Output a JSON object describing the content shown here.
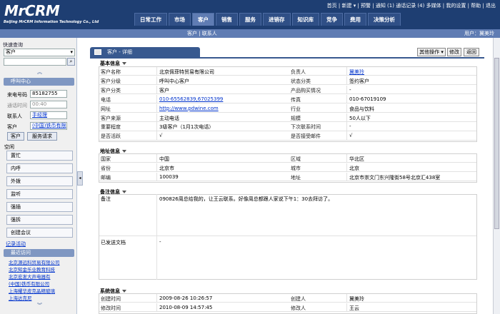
{
  "header": {
    "logo": "MrCRM",
    "logo_sub": "BeiJing MrCRM Information Technology Co., Ltd",
    "toplinks": "首页 | 新建 ▾ | 预警 | 通知 (1) 通话记录 (4) 多媒体 | 我的设置 | 帮助 | 退出",
    "nav": [
      "日常工作",
      "市场",
      "客户",
      "销售",
      "服务",
      "进销存",
      "知识库",
      "竞争",
      "费用",
      "决策分析"
    ],
    "active_nav": "客户",
    "breadcrumb": "客户 | 联系人",
    "user": "用户：冀美玲"
  },
  "left": {
    "quick_title": "快速查询",
    "quick_select": "客户",
    "call_center_title": "呼叫中心",
    "caller_label": "来电号码",
    "caller_value": "85182755",
    "duration_label": "通话时间",
    "duration_value": "00:40",
    "contact_label": "联系人",
    "contact_value": "手经理",
    "customer_label": "客户",
    "customer_value": "(中国)铁币有限",
    "btn_customer": "客户",
    "btn_service": "服务请求",
    "status_label": "空闲",
    "actions": [
      "置忙",
      "内呼",
      "外拨",
      "监听",
      "强插",
      "强拆",
      "创建会议"
    ],
    "record_link": "记录活动",
    "recent_title": "最近访问",
    "recent": [
      "北京源远科贸易有限公司",
      "北京知金乐业教育科技",
      "北京宏发大声电器有",
      "(中国)铁币有限公司",
      "上海耀华皮克晶精玻璃",
      "上海达克尼"
    ]
  },
  "toolbar": {
    "tab_title": "客户 - 详细",
    "more_actions": "其他操作 ▾",
    "edit": "修改",
    "back": "返回"
  },
  "basic": {
    "title": "基本信息",
    "rows": [
      {
        "k1": "客户名称",
        "v1": "北京佩菲特贸易有限公司",
        "k2": "负责人",
        "v2": "冀美玲"
      },
      {
        "k1": "客户分级",
        "v1": "呼叫中心客户",
        "k2": "状态分类",
        "v2": "签约客户"
      },
      {
        "k1": "客户分类",
        "v1": "客户",
        "k2": "产品购买情况",
        "v2": "-"
      },
      {
        "k1": "电话",
        "v1": "010-65562839,67025399",
        "k2": "传真",
        "v2": "010-67019109"
      },
      {
        "k1": "网址",
        "v1": "http://www.pdwine.com",
        "k2": "行业",
        "v2": "食品与饮料"
      },
      {
        "k1": "客户来源",
        "v1": "主动电话",
        "k2": "规模",
        "v2": "50人以下"
      },
      {
        "k1": "重要程度",
        "v1": "3级客户（1月1次电话）",
        "k2": "下次联系时间",
        "v2": "-"
      },
      {
        "k1": "是否活跃",
        "v1": "√",
        "k2": "是否接受邮件",
        "v2": "√"
      }
    ]
  },
  "address": {
    "title": "地址信息",
    "rows": [
      {
        "k1": "国家",
        "v1": "中国",
        "k2": "区域",
        "v2": "华北区"
      },
      {
        "k1": "省份",
        "v1": "北京市",
        "k2": "城市",
        "v2": "北京"
      },
      {
        "k1": "邮编",
        "v1": "100039",
        "k2": "地址",
        "v2": "北京市崇文门东兴隆街58号北京汇438室"
      }
    ]
  },
  "notes": {
    "title": "备注信息",
    "note_label": "备注",
    "note_value": "090826周总给我的，让王云联系。好像周总都跟人家说下午1：30去拜访了。",
    "doc_label": "已发送文档",
    "doc_value": "-"
  },
  "system": {
    "title": "系统信息",
    "rows": [
      {
        "k1": "创建时间",
        "v1": "2009-08-26 10:26:57",
        "k2": "创建人",
        "v2": "冀美玲"
      },
      {
        "k1": "修改时间",
        "v1": "2010-08-09 14:57:45",
        "k2": "修改人",
        "v2": "王云"
      }
    ]
  }
}
